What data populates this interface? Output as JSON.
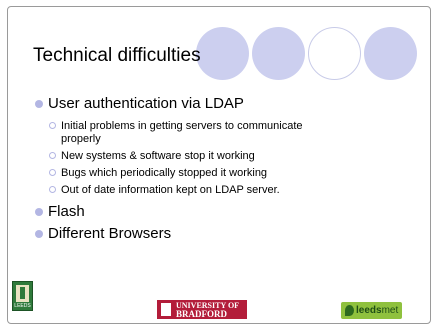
{
  "slide": {
    "title": "Technical difficulties",
    "bullets": [
      {
        "text": "User authentication via LDAP",
        "sub": [
          "Initial problems in getting servers to communicate properly",
          "New systems & software stop it working",
          "Bugs which periodically stopped it working",
          "Out of date information kept on LDAP server."
        ]
      },
      {
        "text": "Flash"
      },
      {
        "text": "Different Browsers"
      }
    ]
  },
  "logos": {
    "leeds": {
      "text": "LEEDS"
    },
    "bradford": {
      "line1": "UNIVERSITY OF",
      "line2": "BRADFORD"
    },
    "leedsmet": {
      "prefix": "leeds",
      "suffix": "met"
    }
  },
  "colors": {
    "circle_fill": "#cccfef",
    "bullet": "#b3b6e3",
    "bradford_red": "#b31d3a",
    "leedsmet_green": "#8fc13e"
  }
}
